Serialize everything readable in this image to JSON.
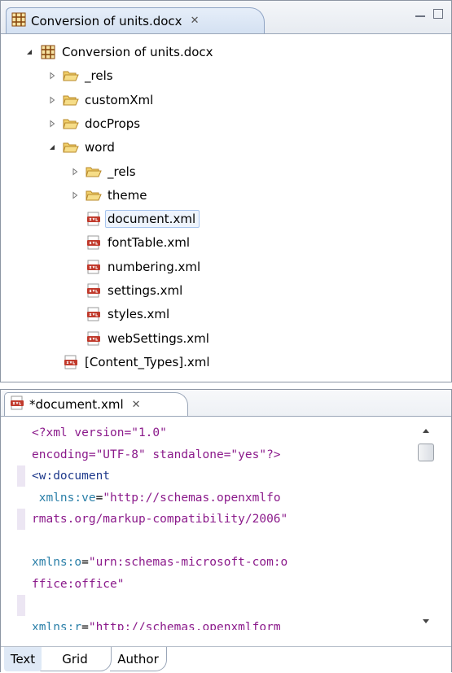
{
  "project_panel": {
    "tab_title": "Conversion of units.docx",
    "tab_close": "✕",
    "tree": [
      {
        "label": "Conversion of units.docx",
        "icon": "archive-icon",
        "state": "expanded",
        "level": 0
      },
      {
        "label": "_rels",
        "icon": "folder-icon",
        "state": "collapsed",
        "level": 1
      },
      {
        "label": "customXml",
        "icon": "folder-icon",
        "state": "collapsed",
        "level": 1
      },
      {
        "label": "docProps",
        "icon": "folder-icon",
        "state": "collapsed",
        "level": 1
      },
      {
        "label": "word",
        "icon": "folder-icon",
        "state": "expanded",
        "level": 1
      },
      {
        "label": "_rels",
        "icon": "folder-icon",
        "state": "collapsed",
        "level": 2
      },
      {
        "label": "theme",
        "icon": "folder-icon",
        "state": "collapsed",
        "level": 2
      },
      {
        "label": "document.xml",
        "icon": "xml-file-icon",
        "state": "leaf",
        "level": 2,
        "selected": true
      },
      {
        "label": "fontTable.xml",
        "icon": "xml-file-icon",
        "state": "leaf",
        "level": 2
      },
      {
        "label": "numbering.xml",
        "icon": "xml-file-icon",
        "state": "leaf",
        "level": 2
      },
      {
        "label": "settings.xml",
        "icon": "xml-file-icon",
        "state": "leaf",
        "level": 2
      },
      {
        "label": "styles.xml",
        "icon": "xml-file-icon",
        "state": "leaf",
        "level": 2
      },
      {
        "label": "webSettings.xml",
        "icon": "xml-file-icon",
        "state": "leaf",
        "level": 2
      },
      {
        "label": "[Content_Types].xml",
        "icon": "xml-file-icon",
        "state": "leaf",
        "level": 1
      }
    ]
  },
  "editor": {
    "tab_title": "*document.xml",
    "tab_close": "✕",
    "code_lines": [
      [
        {
          "t": "<?xml version=\"1.0\"",
          "c": "pi"
        }
      ],
      [
        {
          "t": "encoding=\"UTF-8\" standalone=\"yes\"?>",
          "c": "pi"
        }
      ],
      [
        {
          "t": "<w:document",
          "c": "tag"
        }
      ],
      [
        {
          "t": " xmlns:ve",
          "c": "attr"
        },
        {
          "t": "=",
          "c": "eq"
        },
        {
          "t": "\"http://schemas.openxmlfo",
          "c": "str"
        }
      ],
      [
        {
          "t": "rmats.org/markup-compatibility/2006\"",
          "c": "str"
        }
      ],
      [
        {
          "t": "",
          "c": "eq"
        }
      ],
      [
        {
          "t": "xmlns:o",
          "c": "attr"
        },
        {
          "t": "=",
          "c": "eq"
        },
        {
          "t": "\"urn:schemas-microsoft-com:o",
          "c": "str"
        }
      ],
      [
        {
          "t": "ffice:office\"",
          "c": "str"
        }
      ],
      [
        {
          "t": "",
          "c": "eq"
        }
      ],
      [
        {
          "t": "xmlns:r",
          "c": "attr"
        },
        {
          "t": "=",
          "c": "eq"
        },
        {
          "t": "\"http://schemas.openxmlform",
          "c": "str"
        }
      ]
    ],
    "modes": [
      "Text",
      "Grid",
      "Author"
    ],
    "active_mode": "Text"
  },
  "colors": {
    "pi": "#8b1a8b",
    "attr": "#2a7fa8",
    "string": "#8b1a8b",
    "tag": "#1f3a8c",
    "selection_border": "#a8c5ee",
    "folder": "#e8b84a"
  }
}
